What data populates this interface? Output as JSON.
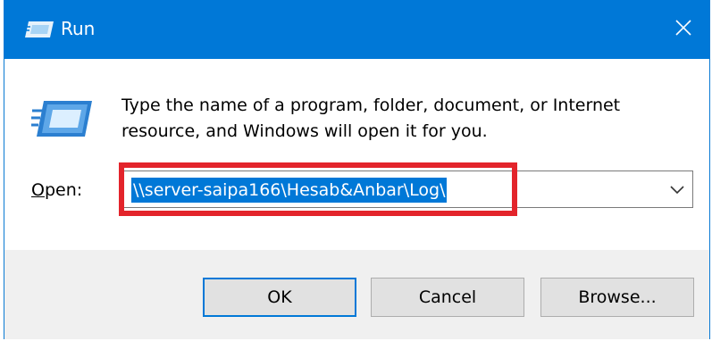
{
  "window": {
    "title": "Run",
    "accent_color": "#0078d7",
    "title_icon": "run-icon",
    "close_icon": "close-icon"
  },
  "content": {
    "icon": "run-app-icon",
    "description": "Type the name of a program, folder, document, or Internet resource, and Windows will open it for you.",
    "open_label_underlined": "O",
    "open_label_rest": "pen:",
    "open_value": "\\\\server-saipa166\\Hesab&Anbar\\Log\\",
    "dropdown_icon": "chevron-down-icon",
    "highlight_color": "#e3242b"
  },
  "buttons": {
    "ok": "OK",
    "cancel": "Cancel",
    "browse": "Browse..."
  }
}
